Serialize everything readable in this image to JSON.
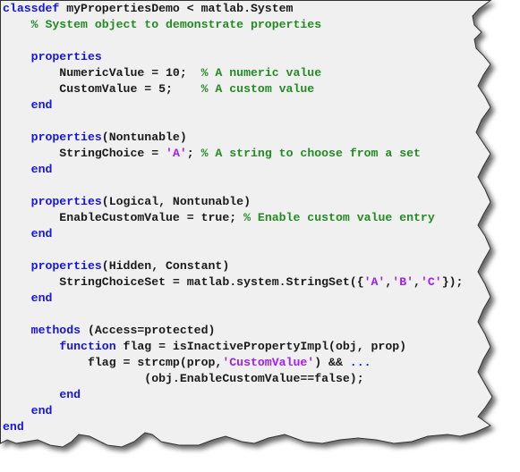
{
  "editor": {
    "colors": {
      "background": "#f0f0f0",
      "keyword": "#1414e6",
      "comment": "#228b22",
      "string": "#a020f0",
      "text": "#1a1a1a",
      "border": "#333333"
    },
    "lines": [
      [
        {
          "t": "kw",
          "s": "classdef"
        },
        {
          "t": "plain",
          "s": " myPropertiesDemo < matlab.System"
        }
      ],
      [
        {
          "t": "plain",
          "s": "    "
        },
        {
          "t": "cm",
          "s": "% System object to demonstrate properties"
        }
      ],
      [],
      [
        {
          "t": "plain",
          "s": "    "
        },
        {
          "t": "kw",
          "s": "properties"
        }
      ],
      [
        {
          "t": "plain",
          "s": "        NumericValue = 10;  "
        },
        {
          "t": "cm",
          "s": "% A numeric value"
        }
      ],
      [
        {
          "t": "plain",
          "s": "        CustomValue = 5;    "
        },
        {
          "t": "cm",
          "s": "% A custom value"
        }
      ],
      [
        {
          "t": "plain",
          "s": "    "
        },
        {
          "t": "kw",
          "s": "end"
        }
      ],
      [],
      [
        {
          "t": "plain",
          "s": "    "
        },
        {
          "t": "kw",
          "s": "properties"
        },
        {
          "t": "plain",
          "s": "(Nontunable)"
        }
      ],
      [
        {
          "t": "plain",
          "s": "        StringChoice = "
        },
        {
          "t": "str",
          "s": "'A'"
        },
        {
          "t": "plain",
          "s": "; "
        },
        {
          "t": "cm",
          "s": "% A string to choose from a set"
        }
      ],
      [
        {
          "t": "plain",
          "s": "    "
        },
        {
          "t": "kw",
          "s": "end"
        }
      ],
      [],
      [
        {
          "t": "plain",
          "s": "    "
        },
        {
          "t": "kw",
          "s": "properties"
        },
        {
          "t": "plain",
          "s": "(Logical, Nontunable)"
        }
      ],
      [
        {
          "t": "plain",
          "s": "        EnableCustomValue = true; "
        },
        {
          "t": "cm",
          "s": "% Enable custom value entry"
        }
      ],
      [
        {
          "t": "plain",
          "s": "    "
        },
        {
          "t": "kw",
          "s": "end"
        }
      ],
      [],
      [
        {
          "t": "plain",
          "s": "    "
        },
        {
          "t": "kw",
          "s": "properties"
        },
        {
          "t": "plain",
          "s": "(Hidden, Constant)"
        }
      ],
      [
        {
          "t": "plain",
          "s": "        StringChoiceSet = matlab.system.StringSet({"
        },
        {
          "t": "str",
          "s": "'A'"
        },
        {
          "t": "plain",
          "s": ","
        },
        {
          "t": "str",
          "s": "'B'"
        },
        {
          "t": "plain",
          "s": ","
        },
        {
          "t": "str",
          "s": "'C'"
        },
        {
          "t": "plain",
          "s": "});"
        }
      ],
      [
        {
          "t": "plain",
          "s": "    "
        },
        {
          "t": "kw",
          "s": "end"
        }
      ],
      [],
      [
        {
          "t": "plain",
          "s": "    "
        },
        {
          "t": "kw",
          "s": "methods"
        },
        {
          "t": "plain",
          "s": " (Access=protected)"
        }
      ],
      [
        {
          "t": "plain",
          "s": "        "
        },
        {
          "t": "kw",
          "s": "function"
        },
        {
          "t": "plain",
          "s": " flag = isInactivePropertyImpl(obj, prop)"
        }
      ],
      [
        {
          "t": "plain",
          "s": "            flag = strcmp(prop,"
        },
        {
          "t": "str",
          "s": "'CustomValue'"
        },
        {
          "t": "plain",
          "s": ") && "
        },
        {
          "t": "cont",
          "s": "..."
        }
      ],
      [
        {
          "t": "plain",
          "s": "                    (obj.EnableCustomValue==false);"
        }
      ],
      [
        {
          "t": "plain",
          "s": "        "
        },
        {
          "t": "kw",
          "s": "end"
        }
      ],
      [
        {
          "t": "plain",
          "s": "    "
        },
        {
          "t": "kw",
          "s": "end"
        }
      ],
      [
        {
          "t": "kw",
          "s": "end"
        }
      ]
    ]
  }
}
